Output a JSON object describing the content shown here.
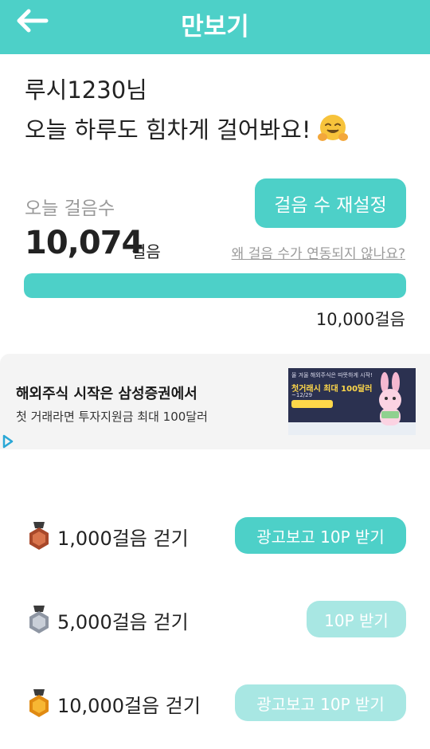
{
  "header": {
    "title": "만보기",
    "back_icon": "arrow-left-icon"
  },
  "greeting": {
    "name": "루시1230님",
    "message": "오늘 하루도 힘차게 걸어봐요!",
    "emoji_icon": "hugging-face-icon"
  },
  "steps": {
    "today_label": "오늘 걸음수",
    "count": "10,074",
    "unit": "걸음",
    "reset_button": "걸음 수 재설정",
    "sync_help": "왜 걸음 수가 연동되지 않나요?",
    "goal_label": "10,000걸음",
    "progress_fraction": 1.0
  },
  "ad": {
    "title": "해외주식 시작은 삼성증권에서",
    "description": "첫 거래라면 투자지원금 최대 100달러",
    "image_top": "올 겨울 해외주식은 따뜻하게 시작!",
    "image_headline": "첫거래시 최대 100달러",
    "image_date": "~12/29",
    "adchoice_icon": "play-triangle-icon"
  },
  "missions": [
    {
      "label": "1,000걸음 걷기",
      "button": "광고보고 10P 받기",
      "medal": "bronze-medal-icon",
      "state": "active"
    },
    {
      "label": "5,000걸음 걷기",
      "button": "10P 받기",
      "medal": "silver-medal-icon",
      "state": "dim"
    },
    {
      "label": "10,000걸음 걷기",
      "button": "광고보고 10P 받기",
      "medal": "gold-medal-icon",
      "state": "dim"
    }
  ],
  "colors": {
    "accent": "#4dd0c8",
    "accent_dim": "#a8e7e3",
    "text": "#222222",
    "muted": "#9a9a9a"
  }
}
